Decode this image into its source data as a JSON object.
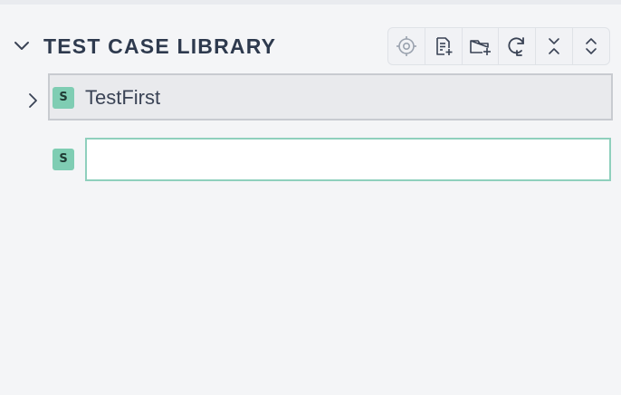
{
  "panel": {
    "title": "TEST CASE LIBRARY",
    "collapse_icon": "chevron-down-icon"
  },
  "toolbar": {
    "buttons": [
      {
        "name": "locate-button",
        "icon": "crosshair-target-icon"
      },
      {
        "name": "new-test-case-button",
        "icon": "add-document-icon"
      },
      {
        "name": "new-folder-button",
        "icon": "add-folder-icon"
      },
      {
        "name": "refresh-button",
        "icon": "refresh-icon"
      },
      {
        "name": "collapse-all-button",
        "icon": "collapse-all-icon"
      },
      {
        "name": "expand-all-button",
        "icon": "expand-all-icon"
      }
    ]
  },
  "tree": {
    "items": [
      {
        "badge": "S",
        "label": "TestFirst",
        "expand_icon": "chevron-right-icon"
      },
      {
        "badge": "S",
        "input_value": "",
        "input_placeholder": ""
      }
    ]
  },
  "colors": {
    "background": "#f4f5f7",
    "badge": "#7fcdb3",
    "input_border": "#8fd0bd",
    "selected_row": "#e9eaed",
    "title": "#2e3a4e"
  }
}
